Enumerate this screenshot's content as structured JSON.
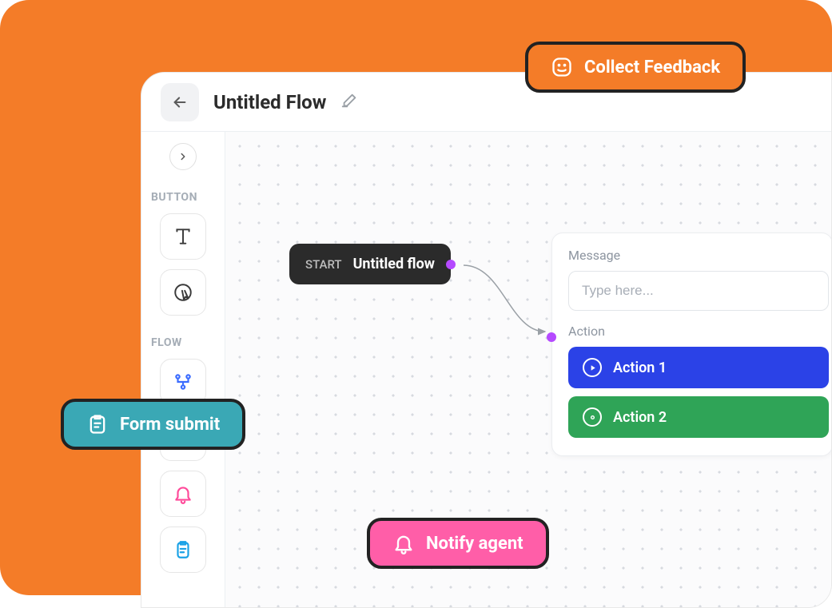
{
  "header": {
    "title": "Untitled Flow"
  },
  "sidebar": {
    "section1_label": "BUTTON",
    "section2_label": "FLOW"
  },
  "canvas": {
    "start_label": "START",
    "start_name": "Untitled flow"
  },
  "panel": {
    "message_label": "Message",
    "message_placeholder": "Type here...",
    "action_label": "Action",
    "action1": "Action 1",
    "action2": "Action 2"
  },
  "chips": {
    "feedback": "Collect Feedback",
    "form": "Form submit",
    "notify": "Notify agent"
  }
}
